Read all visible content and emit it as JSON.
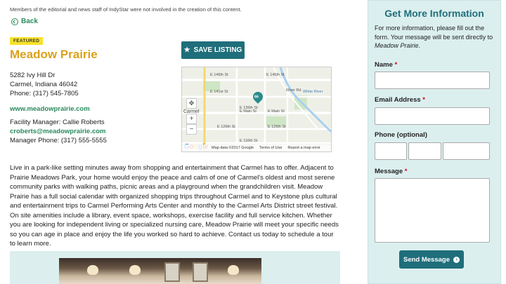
{
  "disclaimer": "Members of the editorial and news staff of IndyStar were not involved in the creation of this content.",
  "back_label": "Back",
  "badge": "FEATURED",
  "title": "Meadow Prairie",
  "save_label": "SAVE LISTING",
  "address": {
    "street": "5282 Ivy Hill Dr",
    "city": "Carmel, Indiana 46042",
    "phone": "Phone: (317) 545-7805"
  },
  "website": "www.meadowprairie.com",
  "manager": {
    "name": "Facility Manager: Callie Roberts",
    "email": "croberts@meadowprairie.com",
    "phone": "Manager Phone: (317) 555-5555"
  },
  "map": {
    "labels": [
      "E 146th St",
      "E 146th St",
      "E 141st St",
      "E 136th St",
      "E Main St",
      "E Main St",
      "E 126th St",
      "E 126th St",
      "E 116th St",
      "Carmel",
      "River Rd",
      "White River"
    ],
    "pin_label": "66",
    "zoom_in": "+",
    "zoom_out": "−",
    "footer": [
      "Map data ©2017 Google",
      "Terms of Use",
      "Report a map error"
    ],
    "logo": [
      "G",
      "o",
      "o",
      "g",
      "l",
      "e"
    ]
  },
  "description": "Live in a park-like setting minutes away from shopping and entertainment that Carmel has to offer. Adjacent to Prairie Meadows Park, your home would enjoy the peace and calm of one of Carmel's oldest and most serene community parks with walking paths, picnic areas and a playground when the grandchildren visit. Meadow Prairie has a full social calendar with organized shopping trips throughout Carmel and to Keystone plus cultural and entertainment trips to Carmel Performing Arts Center and monthly to the Carmel Arts District street festival. On site amenities include a library, event space, workshops, exercise facility and full service kitchen. Whether you are looking for independent living or specialized nursing care, Meadow Prairie will meet your specific needs so you can age in place and enjoy the life you worked so hard to achieve. Contact us today to schedule a tour to learn more.",
  "sidebar": {
    "title": "Get More Information",
    "intro_prefix": "For more information, please fill out the form. Your message will be sent directly to ",
    "intro_name": "Meadow Prairie",
    "intro_suffix": ".",
    "name_label": "Name",
    "email_label": "Email Address",
    "phone_label": "Phone (optional)",
    "message_label": "Message",
    "required_mark": "*",
    "send_label": "Send Message",
    "send_icon": "›"
  },
  "colors": {
    "accent": "#1f6e7b",
    "title_gold": "#d9a21c",
    "link_green": "#2a8a5e",
    "badge_yellow": "#f7e12a",
    "sidebar_bg": "#dcefef",
    "required_red": "#d0021b"
  }
}
